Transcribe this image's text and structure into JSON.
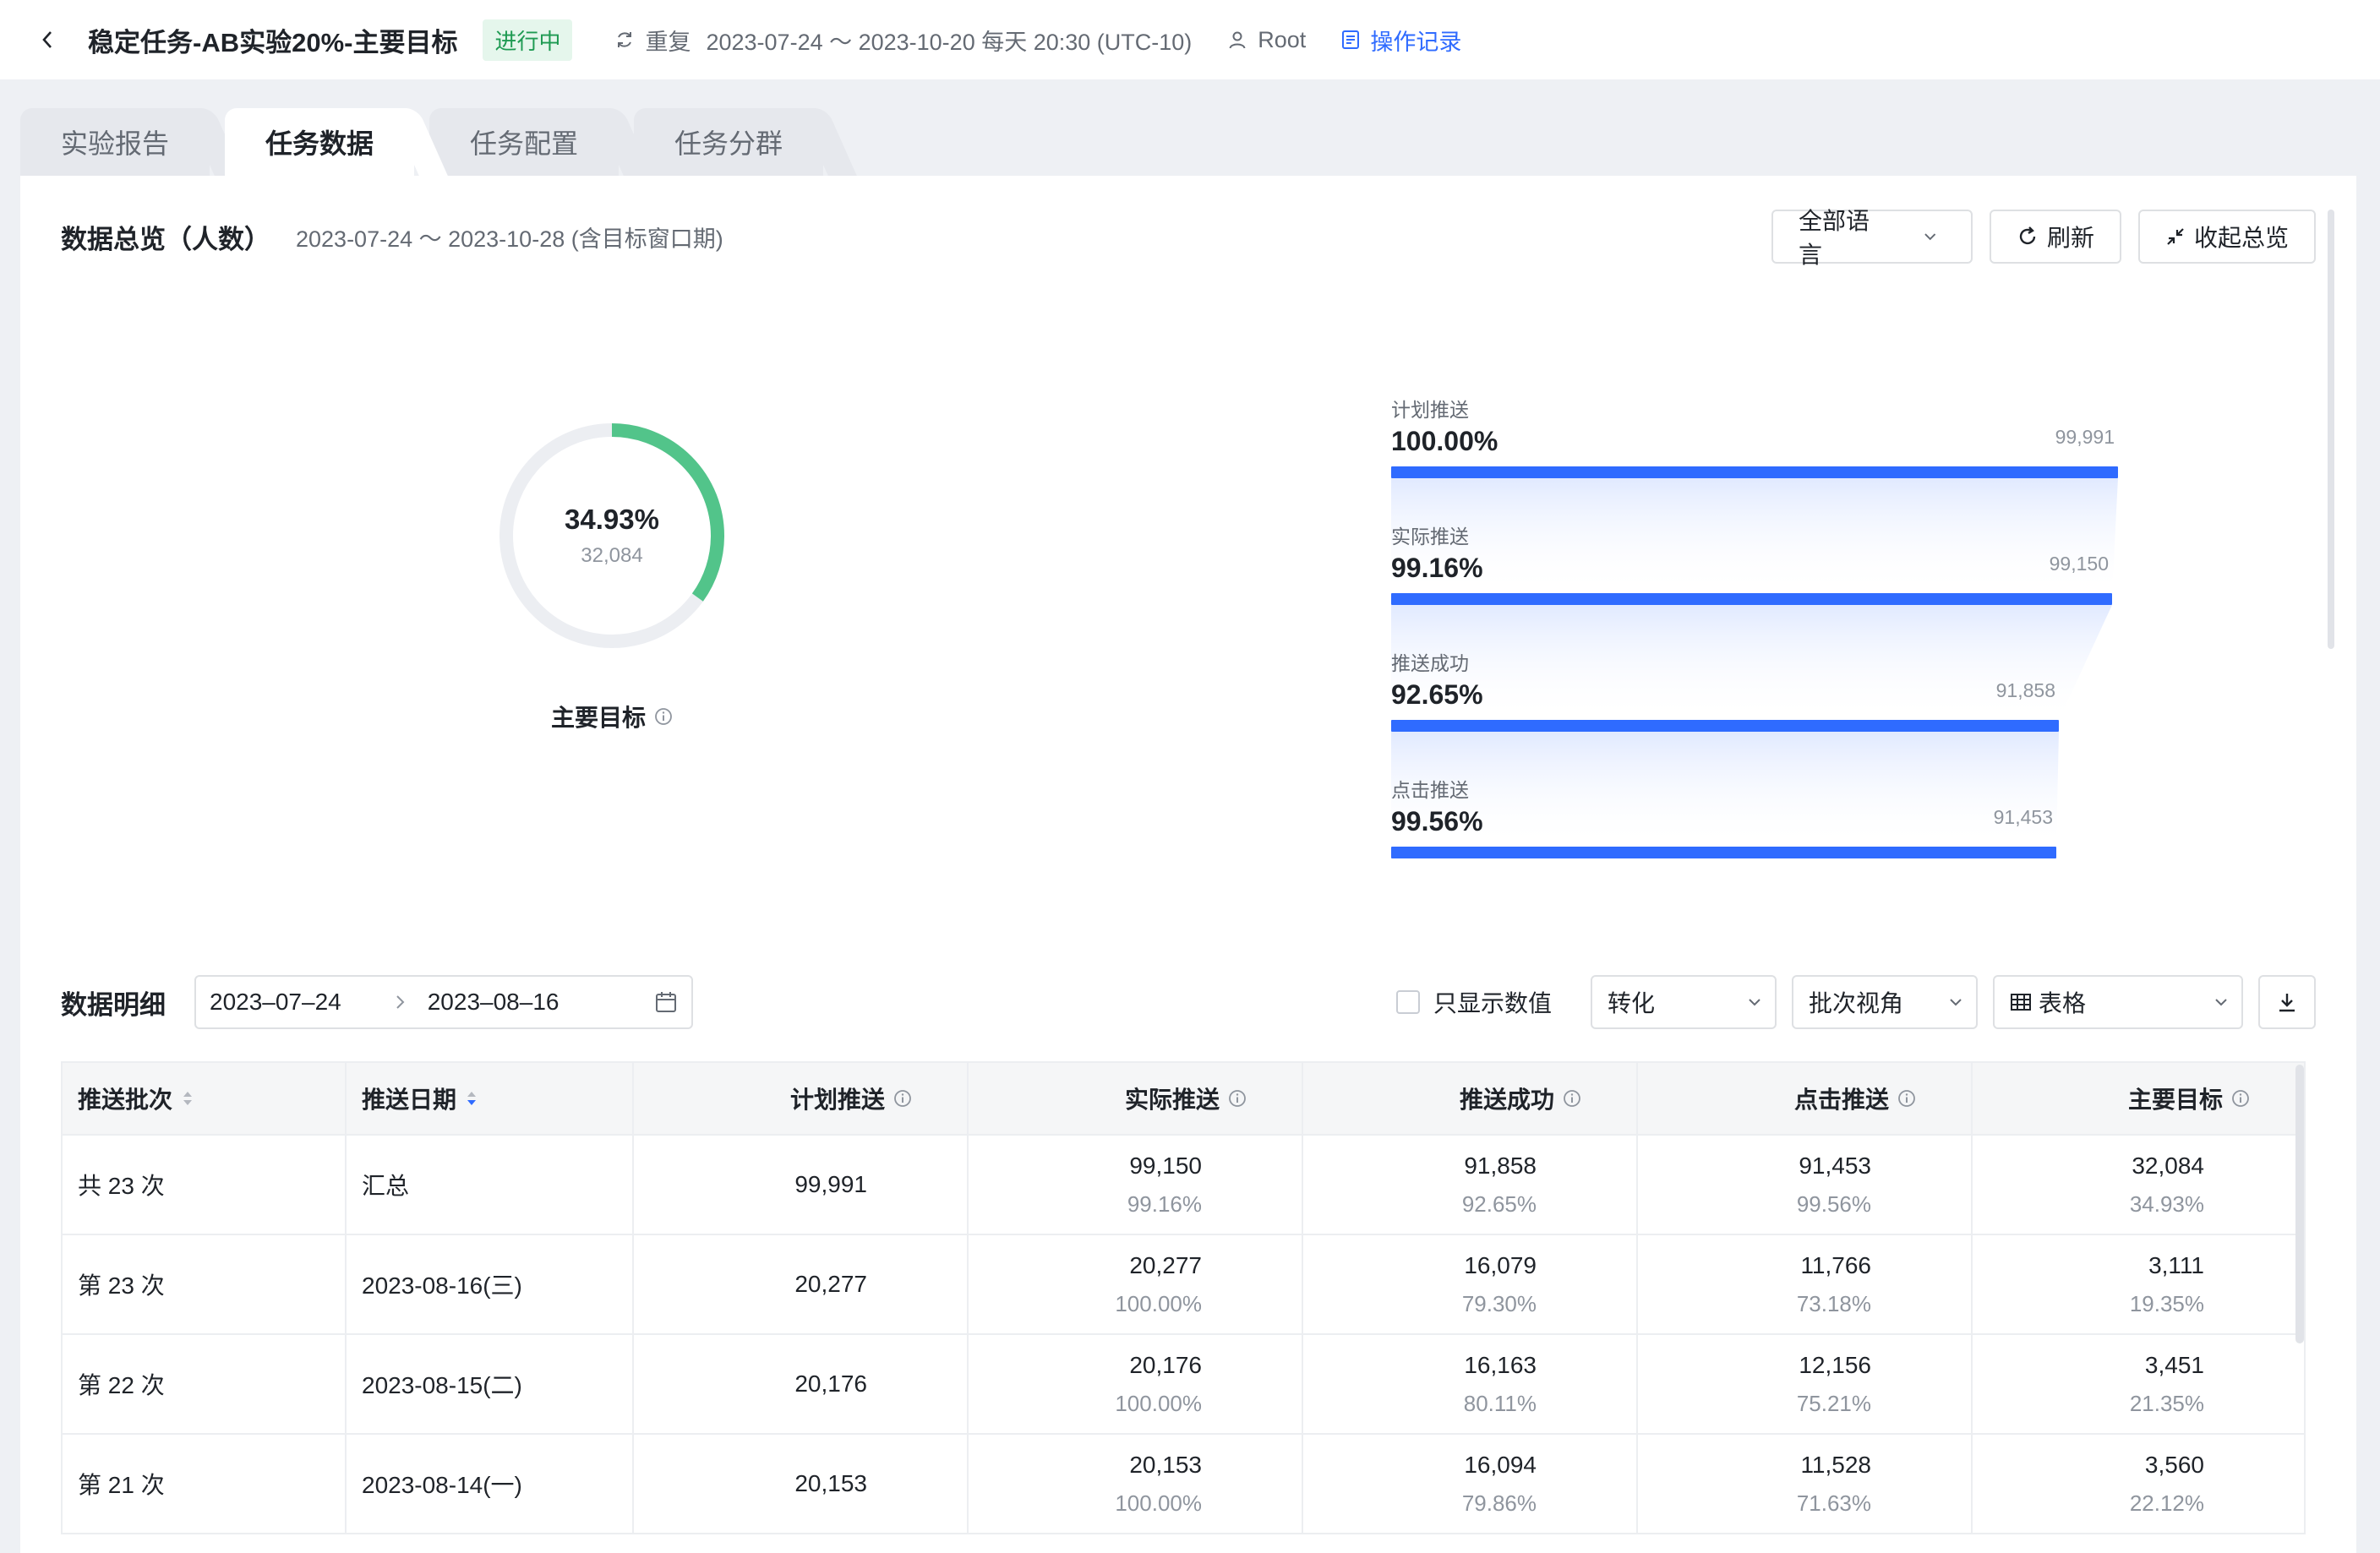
{
  "header": {
    "title": "稳定任务-AB实验20%-主要目标",
    "status": "进行中",
    "repeat_label": "重复",
    "schedule": "2023-07-24 ～ 2023-10-20 每天 20:30 (UTC-10)",
    "owner": "Root",
    "oplog": "操作记录"
  },
  "tabs": [
    {
      "label": "实验报告",
      "active": false
    },
    {
      "label": "任务数据",
      "active": true
    },
    {
      "label": "任务配置",
      "active": false
    },
    {
      "label": "任务分群",
      "active": false
    }
  ],
  "overview": {
    "title": "数据总览（人数）",
    "range": "2023-07-24 ～ 2023-10-28 (含目标窗口期)",
    "language_select": "全部语言",
    "refresh": "刷新",
    "collapse": "收起总览",
    "donut": {
      "percent": "34.93%",
      "count": "32,084",
      "label": "主要目标",
      "fraction": 0.3493,
      "color": "#52c48a"
    },
    "funnel": [
      {
        "label": "计划推送",
        "percent": "100.00%",
        "count": "99,991",
        "ratio": 1.0
      },
      {
        "label": "实际推送",
        "percent": "99.16%",
        "count": "99,150",
        "ratio": 0.9916
      },
      {
        "label": "推送成功",
        "percent": "92.65%",
        "count": "91,858",
        "ratio": 0.9187
      },
      {
        "label": "点击推送",
        "percent": "99.56%",
        "count": "91,453",
        "ratio": 0.9146
      }
    ],
    "bar_color": "#2f6bff"
  },
  "detail": {
    "title": "数据明细",
    "date_start": "2023–07–24",
    "date_end": "2023–08–16",
    "only_values": "只显示数值",
    "mode_select": "转化",
    "view_select": "批次视角",
    "format_select": "表格"
  },
  "table": {
    "columns": [
      "推送批次",
      "推送日期",
      "计划推送",
      "实际推送",
      "推送成功",
      "点击推送",
      "主要目标"
    ],
    "rows": [
      {
        "batch": "共 23 次",
        "date": "汇总",
        "planned": "99,991",
        "actual": "99,150",
        "actual_pct": "99.16%",
        "success": "91,858",
        "success_pct": "92.65%",
        "click": "91,453",
        "click_pct": "99.56%",
        "goal": "32,084",
        "goal_pct": "34.93%"
      },
      {
        "batch": "第 23 次",
        "date": "2023-08-16(三)",
        "planned": "20,277",
        "actual": "20,277",
        "actual_pct": "100.00%",
        "success": "16,079",
        "success_pct": "79.30%",
        "click": "11,766",
        "click_pct": "73.18%",
        "goal": "3,111",
        "goal_pct": "19.35%"
      },
      {
        "batch": "第 22 次",
        "date": "2023-08-15(二)",
        "planned": "20,176",
        "actual": "20,176",
        "actual_pct": "100.00%",
        "success": "16,163",
        "success_pct": "80.11%",
        "click": "12,156",
        "click_pct": "75.21%",
        "goal": "3,451",
        "goal_pct": "21.35%"
      },
      {
        "batch": "第 21 次",
        "date": "2023-08-14(一)",
        "planned": "20,153",
        "actual": "20,153",
        "actual_pct": "100.00%",
        "success": "16,094",
        "success_pct": "79.86%",
        "click": "11,528",
        "click_pct": "71.63%",
        "goal": "3,560",
        "goal_pct": "22.12%"
      }
    ]
  }
}
